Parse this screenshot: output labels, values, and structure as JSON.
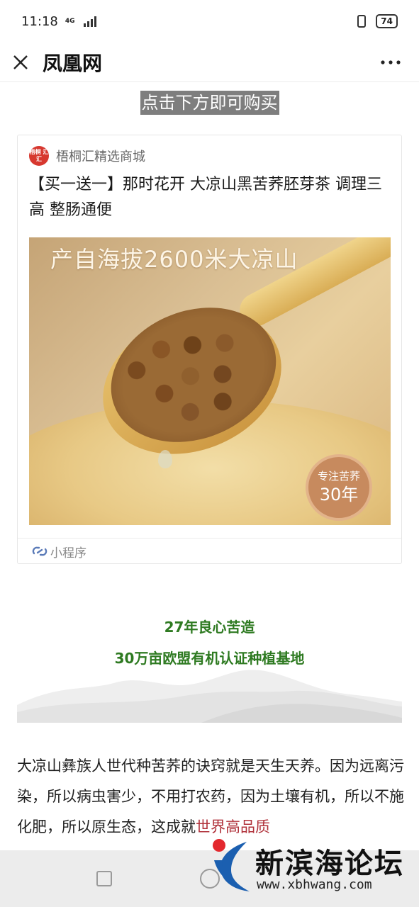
{
  "status": {
    "time": "11:18",
    "network": "4G",
    "battery": "74"
  },
  "nav": {
    "title": "凤凰网",
    "close_icon": "close-icon",
    "more_icon": "more-dots-icon"
  },
  "buy_hint": "点击下方即可购买",
  "card": {
    "shop_logo_text": "梧桐 汇汇",
    "shop_name": "梧桐汇精选商城",
    "title": "【买一送一】那时花开 大凉山黑苦荞胚芽茶 调理三高 整肠通便",
    "image": {
      "headline": "产自海拔2600米大凉山",
      "seal_line1": "专注苦荞",
      "seal_line2": "30年"
    },
    "footer_icon": "link-icon",
    "footer_label": "小程序"
  },
  "section": {
    "line1": "27年良心苦造",
    "line2": "30万亩欧盟有机认证种植基地"
  },
  "article": {
    "text": "大凉山彝族人世代种苦荞的诀窍就是天生天养。因为远离污染，所以病虫害少，不用打农药，因为土壤有机，所以不施化肥，所以原生态，这成就",
    "highlight": "世界高品质"
  },
  "watermark": {
    "name": "新滨海论坛",
    "url": "www.xbhwang.com"
  },
  "colors": {
    "green_heading": "#2e7a21",
    "highlight_red": "#b0313a",
    "buy_hint_bg": "#7e7e7e"
  }
}
